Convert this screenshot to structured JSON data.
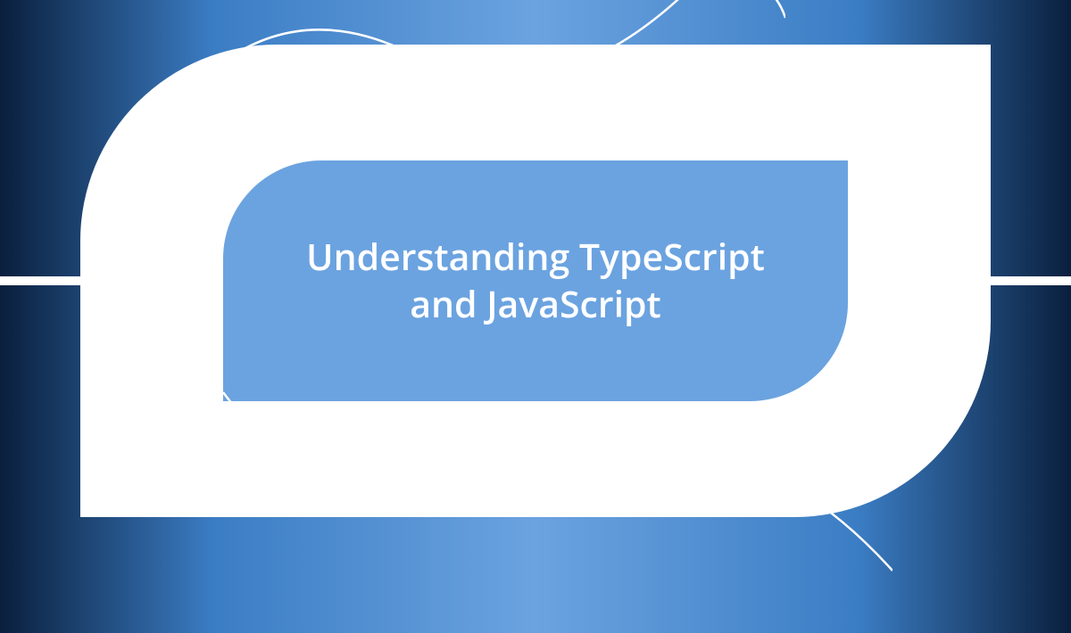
{
  "banner": {
    "title": "Understanding TypeScript and JavaScript"
  },
  "colors": {
    "background_dark": "#0a1f3d",
    "background_mid": "#3b7dc4",
    "background_light": "#6ba3e0",
    "shape": "#ffffff",
    "inner_fill": "#6ba3e0",
    "text": "#ffffff"
  }
}
